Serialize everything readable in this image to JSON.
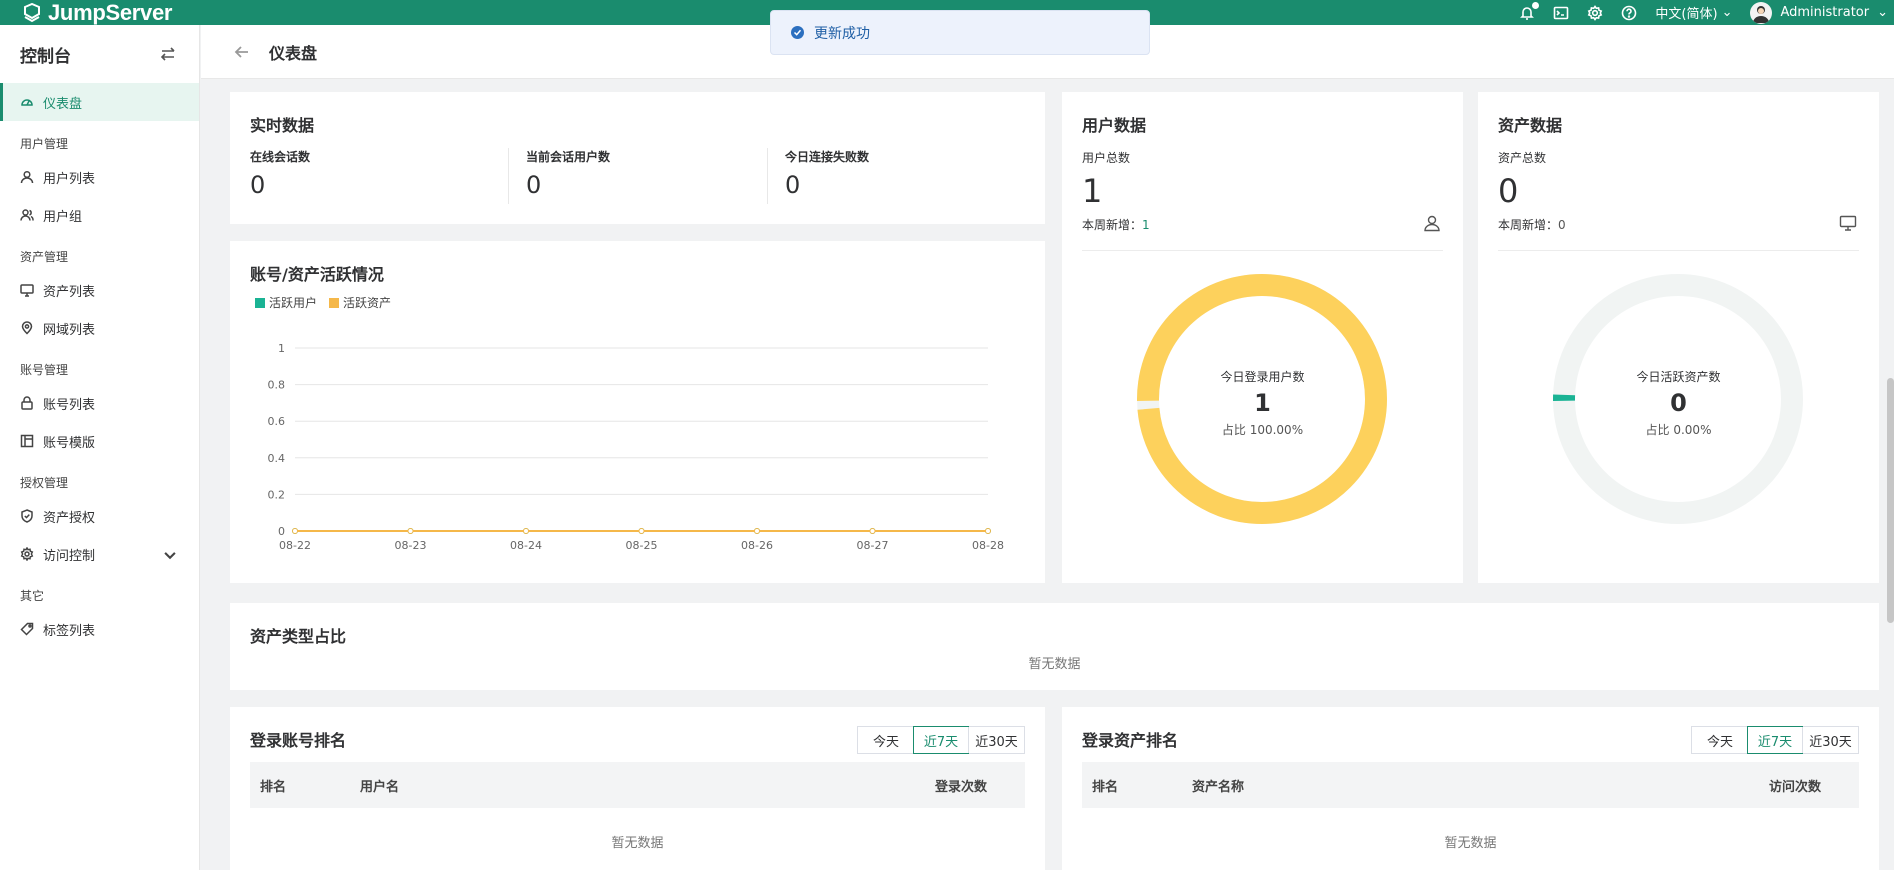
{
  "app": {
    "name": "JumpServer",
    "brand_color": "#1a8c6e"
  },
  "topbar": {
    "language": "中文(简体)",
    "user": "Administrator"
  },
  "toast": {
    "message": "更新成功"
  },
  "sidebar": {
    "title": "控制台",
    "items": [
      {
        "label": "仪表盘",
        "icon": "dashboard-icon",
        "active": true
      },
      {
        "group": "用户管理"
      },
      {
        "label": "用户列表",
        "icon": "user-icon"
      },
      {
        "label": "用户组",
        "icon": "users-icon"
      },
      {
        "group": "资产管理"
      },
      {
        "label": "资产列表",
        "icon": "monitor-icon"
      },
      {
        "label": "网域列表",
        "icon": "location-icon"
      },
      {
        "group": "账号管理"
      },
      {
        "label": "账号列表",
        "icon": "lock-icon"
      },
      {
        "label": "账号模版",
        "icon": "template-icon"
      },
      {
        "group": "授权管理"
      },
      {
        "label": "资产授权",
        "icon": "shield-icon"
      },
      {
        "label": "访问控制",
        "icon": "gear-icon",
        "expandable": true
      },
      {
        "group": "其它"
      },
      {
        "label": "标签列表",
        "icon": "tag-icon"
      }
    ]
  },
  "page": {
    "title": "仪表盘"
  },
  "realtime": {
    "title": "实时数据",
    "stats": [
      {
        "label": "在线会话数",
        "value": "0"
      },
      {
        "label": "当前会话用户数",
        "value": "0"
      },
      {
        "label": "今日连接失败数",
        "value": "0"
      }
    ]
  },
  "activity": {
    "title": "账号/资产活跃情况",
    "legend": [
      "活跃用户",
      "活跃资产"
    ]
  },
  "chart_data": {
    "type": "line",
    "x": [
      "08-22",
      "08-23",
      "08-24",
      "08-25",
      "08-26",
      "08-27",
      "08-28"
    ],
    "series": [
      {
        "name": "活跃用户",
        "values": [
          0,
          0,
          0,
          0,
          0,
          0,
          0
        ],
        "color": "#1ab394"
      },
      {
        "name": "活跃资产",
        "values": [
          0,
          0,
          0,
          0,
          0,
          0,
          0
        ],
        "color": "#f5b84a"
      }
    ],
    "yticks": [
      "0",
      "0.2",
      "0.4",
      "0.6",
      "0.8",
      "1"
    ],
    "ylim": [
      0,
      1
    ],
    "grid": true,
    "legend": "top-left"
  },
  "user_data": {
    "title": "用户数据",
    "total_label": "用户总数",
    "total": "1",
    "week_label": "本周新增：",
    "week_value": "1",
    "donut_label": "今日登录用户数",
    "donut_value": "1",
    "donut_ratio": "占比 100.00%",
    "donut_fraction": 1.0,
    "donut_color": "#fdd15c"
  },
  "asset_data": {
    "title": "资产数据",
    "total_label": "资产总数",
    "total": "0",
    "week_label": "本周新增：",
    "week_value": "0",
    "donut_label": "今日活跃资产数",
    "donut_value": "0",
    "donut_ratio": "占比 0.00%",
    "donut_fraction": 0.0,
    "donut_color": "#1ab394"
  },
  "asset_types": {
    "title": "资产类型占比",
    "empty": "暂无数据"
  },
  "login_account_rank": {
    "title": "登录账号排名",
    "tabs": [
      "今天",
      "近7天",
      "近30天"
    ],
    "active_tab": "近7天",
    "columns": [
      "排名",
      "用户名",
      "登录次数"
    ],
    "empty": "暂无数据"
  },
  "login_asset_rank": {
    "title": "登录资产排名",
    "tabs": [
      "今天",
      "近7天",
      "近30天"
    ],
    "active_tab": "近7天",
    "columns": [
      "排名",
      "资产名称",
      "访问次数"
    ],
    "empty": "暂无数据"
  }
}
